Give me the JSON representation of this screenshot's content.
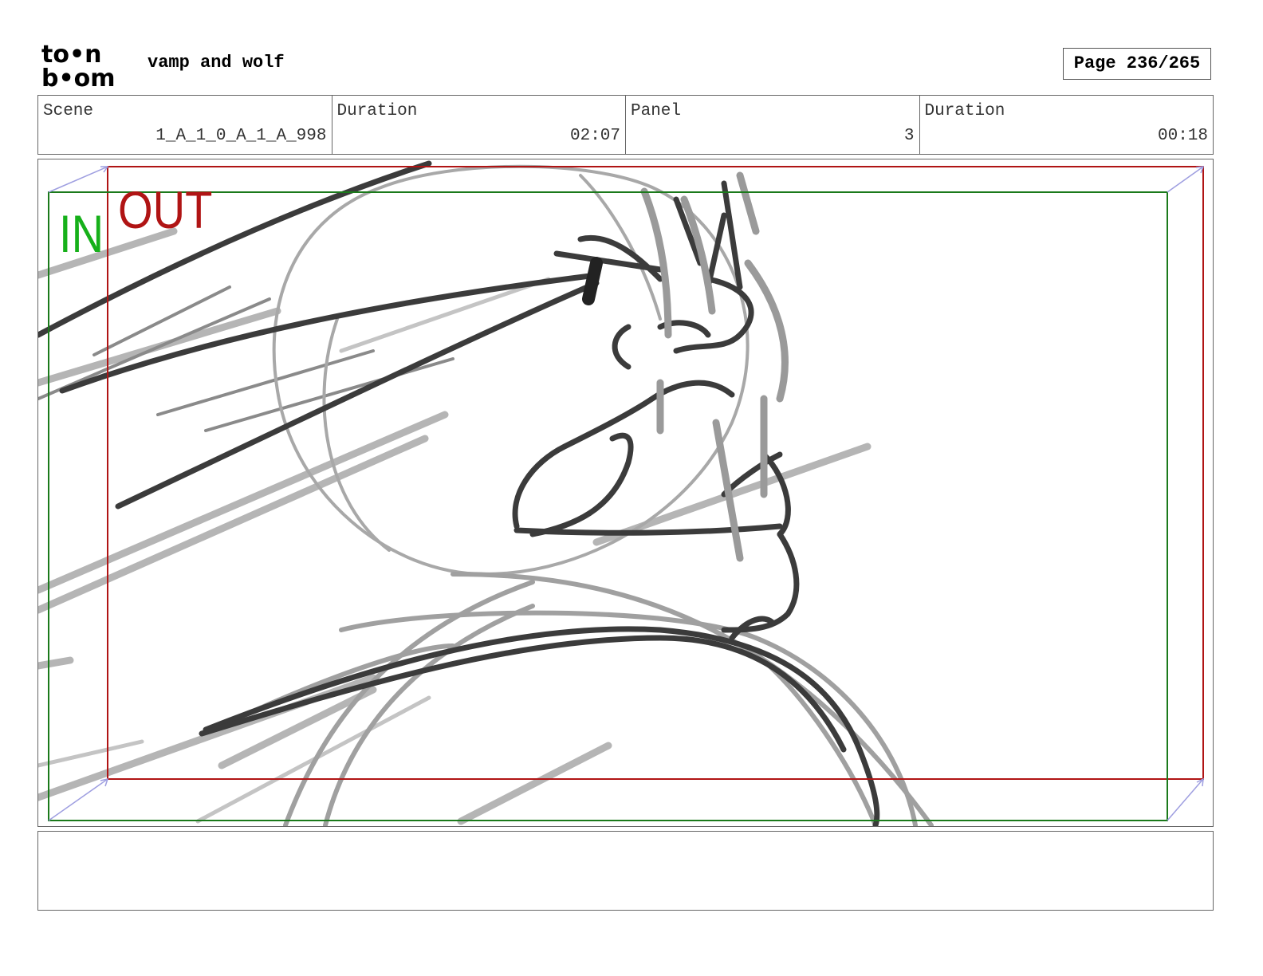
{
  "header": {
    "logo_text_top": "to•n",
    "logo_text_bottom": "b•om",
    "project_title": "vamp and wolf",
    "page_label": "Page 236/265"
  },
  "info": {
    "scene_label": "Scene",
    "scene_value": "1_A_1_0_A_1_A_998",
    "duration_label": "Duration",
    "duration_value": "02:07",
    "panel_label": "Panel",
    "panel_value": "3",
    "panel_duration_label": "Duration",
    "panel_duration_value": "00:18"
  },
  "frame": {
    "in_label": "IN",
    "out_label": "OUT",
    "in_color": "#16b01a",
    "out_color": "#b01414"
  },
  "notes": {
    "text": ""
  }
}
